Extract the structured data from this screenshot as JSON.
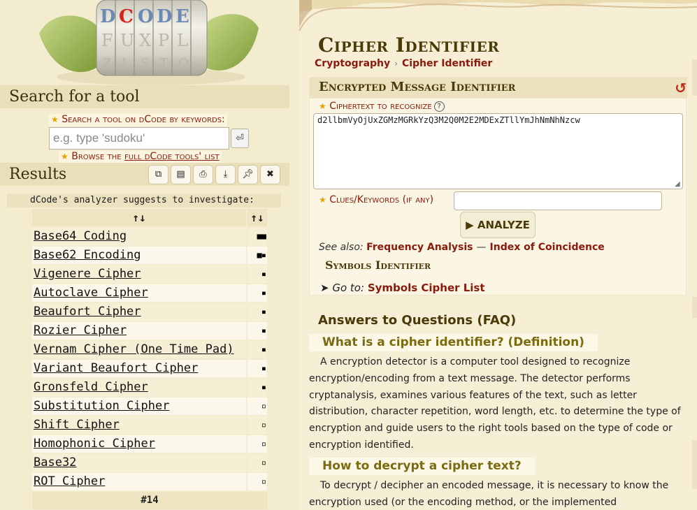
{
  "logo_letters": "DCODE",
  "search": {
    "heading": "Search for a tool",
    "label": "Search a tool on dCode by keywords:",
    "placeholder": "e.g. type 'sudoku'",
    "submit_icon": "enter-icon",
    "browse_prefix": "Browse the ",
    "browse_link": "full dCode tools' list"
  },
  "results": {
    "heading": "Results",
    "toolbar_icons": [
      "copy-icon",
      "save-icon",
      "print-icon",
      "download-icon",
      "pin-icon",
      "close-icon"
    ],
    "analyzer_text": "dCode's analyzer suggests to investigate:",
    "col_name_header": "↑↓",
    "col_score_header": "↑↓",
    "rows": [
      {
        "name": "Base64 Coding",
        "score": "■■"
      },
      {
        "name": "Base62 Encoding",
        "score": "■▪"
      },
      {
        "name": "Vigenere Cipher",
        "score": "▪"
      },
      {
        "name": "Autoclave Cipher",
        "score": "▪"
      },
      {
        "name": "Beaufort Cipher",
        "score": "▪"
      },
      {
        "name": "Rozier Cipher",
        "score": "▪"
      },
      {
        "name": "Vernam Cipher (One Time Pad)",
        "score": "▪"
      },
      {
        "name": "Variant Beaufort Cipher",
        "score": "▪"
      },
      {
        "name": "Gronsfeld Cipher",
        "score": "▪"
      },
      {
        "name": "Substitution Cipher",
        "score": "▫"
      },
      {
        "name": "Shift Cipher",
        "score": "▫"
      },
      {
        "name": "Homophonic Cipher",
        "score": "▫"
      },
      {
        "name": "Base32",
        "score": "▫"
      },
      {
        "name": "ROT Cipher",
        "score": "▫"
      }
    ],
    "total": "#14"
  },
  "page": {
    "title": "Cipher Identifier",
    "breadcrumb": [
      "Cryptography",
      "Cipher Identifier"
    ]
  },
  "tool": {
    "title": "Encrypted Message Identifier",
    "ciphertext_label": "Ciphertext to recognize",
    "ciphertext_value": "d2llbmVyOjUxZGMzMGRkYzQ3M2Q0M2E2MDExZTllYmJhNmNhNzcw",
    "clues_label": "Clues/Keywords (if any)",
    "clues_value": "",
    "analyze_label": "ANALYZE",
    "see_also_label": "See also:",
    "see_also_links": [
      "Frequency Analysis",
      "Index of Coincidence"
    ],
    "symbols_title": "Symbols Identifier",
    "goto_label": "Go to:",
    "goto_link": "Symbols Cipher List"
  },
  "faq": {
    "title": "Answers to Questions (FAQ)",
    "q1": "What is a cipher identifier? (Definition)",
    "a1": "A encryption detector is a computer tool designed to recognize encryption/encoding from a text message. The detector performs cryptanalysis, examines various features of the text, such as letter distribution, character repetition, word length, etc. to determine the type of encryption and guide users to the right tools based on the type of code or encryption identified.",
    "q2": "How to decrypt a cipher text?",
    "a2": "To decrypt / decipher an encoded message, it is necessary to know the encryption used (or the encoding method, or the implemented"
  },
  "colors": {
    "accent_red": "#8a1a0c",
    "title_brown": "#4a3a08",
    "panel_bg": "#f4ecce"
  }
}
